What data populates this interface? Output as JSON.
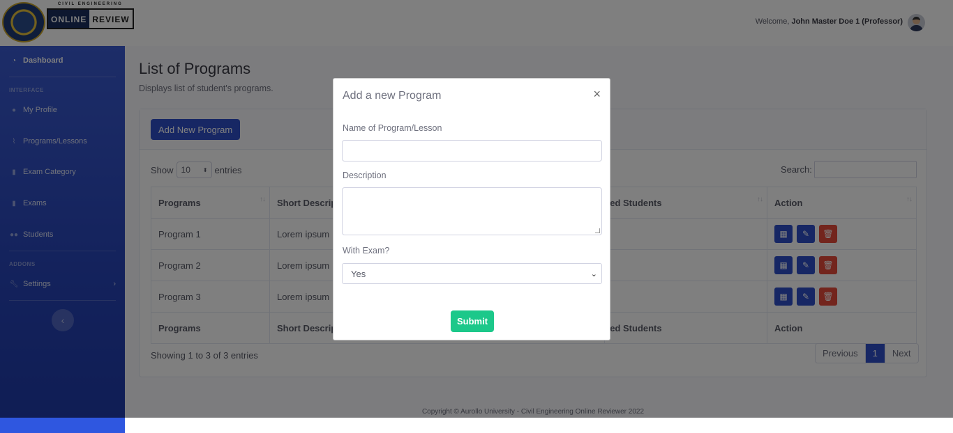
{
  "topbar": {
    "logo": {
      "small_text": "CIVIL ENGINEERING",
      "online": "ONLINE",
      "review": "REVIEW"
    },
    "welcome_prefix": "Welcome,",
    "user_name": "John Master Doe 1 (Professor)"
  },
  "sidebar": {
    "dashboard": "Dashboard",
    "heading_interface": "INTERFACE",
    "my_profile": "My Profile",
    "programs": "Programs/Lessons",
    "exam_category": "Exam Category",
    "exams": "Exams",
    "students": "Students",
    "heading_addons": "ADDONS",
    "settings": "Settings"
  },
  "page": {
    "title": "List of Programs",
    "subtitle": "Displays list of student's programs.",
    "add_button": "Add New Program",
    "show_label": "Show",
    "entries_value": "10",
    "entries_label": "entries",
    "search_label": "Search:",
    "table": {
      "headers": [
        "Programs",
        "Short Descrip",
        "lled Students",
        "Action"
      ],
      "rows": [
        {
          "program": "Program 1",
          "desc": "Lorem ipsum"
        },
        {
          "program": "Program 2",
          "desc": "Lorem ipsum"
        },
        {
          "program": "Program 3",
          "desc": "Lorem ipsum"
        }
      ],
      "footers": [
        "Programs",
        "Short Descrip",
        "lled Students",
        "Action"
      ]
    },
    "showing": "Showing 1 to 3 of 3 entries",
    "pager": {
      "prev": "Previous",
      "current": "1",
      "next": "Next"
    },
    "copyright": "Copyright © Aurollo University - Civil Engineering Online Reviewer 2022"
  },
  "modal": {
    "title": "Add a new Program",
    "close": "×",
    "name_label": "Name of Program/Lesson",
    "name_value": "",
    "description_label": "Description",
    "description_value": "",
    "exam_label": "With Exam?",
    "exam_value": "Yes",
    "submit": "Submit"
  },
  "colors": {
    "primary": "#2f4fc9",
    "sidebar": "#2744b8",
    "success": "#1cc88a",
    "danger": "#e74a3b"
  }
}
